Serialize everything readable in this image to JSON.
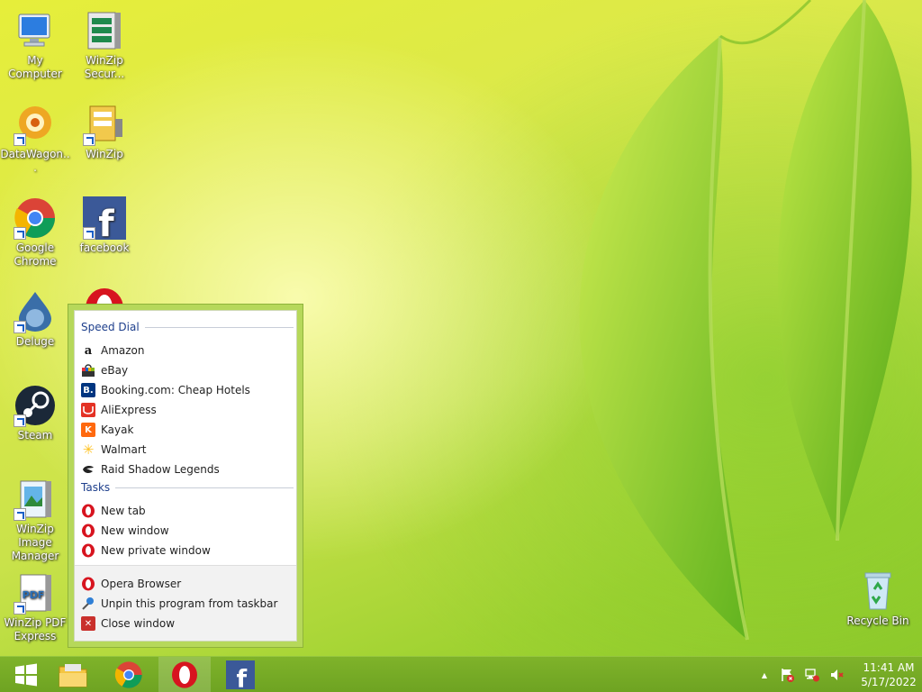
{
  "desktop": {
    "icons": [
      {
        "label": "My Computer"
      },
      {
        "label": "WinZip Secur..."
      },
      {
        "label": "DataWagon..."
      },
      {
        "label": "WinZip"
      },
      {
        "label": "Google Chrome"
      },
      {
        "label": "facebook"
      },
      {
        "label": "Deluge"
      },
      {
        "label": "Steam"
      },
      {
        "label": "WinZip Image Manager"
      },
      {
        "label": "WinZip PDF Express"
      },
      {
        "label": "Recycle Bin"
      }
    ]
  },
  "jumplist": {
    "speed_dial_title": "Speed Dial",
    "speed_dial": [
      {
        "label": "Amazon",
        "icon": "amazon-icon"
      },
      {
        "label": "eBay",
        "icon": "ebay-icon"
      },
      {
        "label": "Booking.com: Cheap Hotels",
        "icon": "booking-icon"
      },
      {
        "label": "AliExpress",
        "icon": "aliexpress-icon"
      },
      {
        "label": "Kayak",
        "icon": "kayak-icon"
      },
      {
        "label": "Walmart",
        "icon": "walmart-icon"
      },
      {
        "label": "Raid Shadow Legends",
        "icon": "raid-icon"
      }
    ],
    "tasks_title": "Tasks",
    "tasks": [
      {
        "label": "New tab"
      },
      {
        "label": "New window"
      },
      {
        "label": "New private window"
      }
    ],
    "footer": [
      {
        "label": "Opera Browser"
      },
      {
        "label": "Unpin this program from taskbar"
      },
      {
        "label": "Close window"
      }
    ]
  },
  "taskbar": {
    "clock_time": "11:41 AM",
    "clock_date": "5/17/2022",
    "tray_arrow": "▲"
  },
  "colors": {
    "taskbar": "#7fb32a",
    "opera_red": "#d7141f",
    "jumplist_header": "#1e3f8c"
  }
}
